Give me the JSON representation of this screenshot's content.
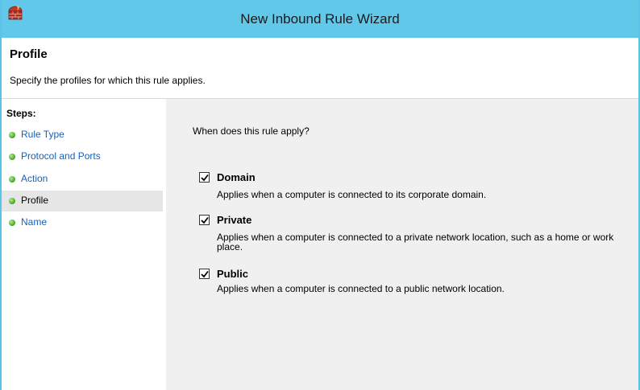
{
  "window": {
    "title": "New Inbound Rule Wizard",
    "icon": "firewall-icon"
  },
  "header": {
    "title": "Profile",
    "subtitle": "Specify the profiles for which this rule applies."
  },
  "steps": {
    "heading": "Steps:",
    "items": [
      {
        "label": "Rule Type",
        "active": false
      },
      {
        "label": "Protocol and Ports",
        "active": false
      },
      {
        "label": "Action",
        "active": false
      },
      {
        "label": "Profile",
        "active": true
      },
      {
        "label": "Name",
        "active": false
      }
    ]
  },
  "content": {
    "question": "When does this rule apply?",
    "options": [
      {
        "label": "Domain",
        "checked": true,
        "description": "Applies when a computer is connected to its corporate domain."
      },
      {
        "label": "Private",
        "checked": true,
        "description": "Applies when a computer is connected to a private network location, such as a home or work place."
      },
      {
        "label": "Public",
        "checked": true,
        "description": "Applies when a computer is connected to a public network location."
      }
    ]
  },
  "colors": {
    "titlebar": "#62c8ea",
    "link": "#1560bd",
    "step_dot": "#4caf2c",
    "content_bg": "#f0f0f0"
  }
}
